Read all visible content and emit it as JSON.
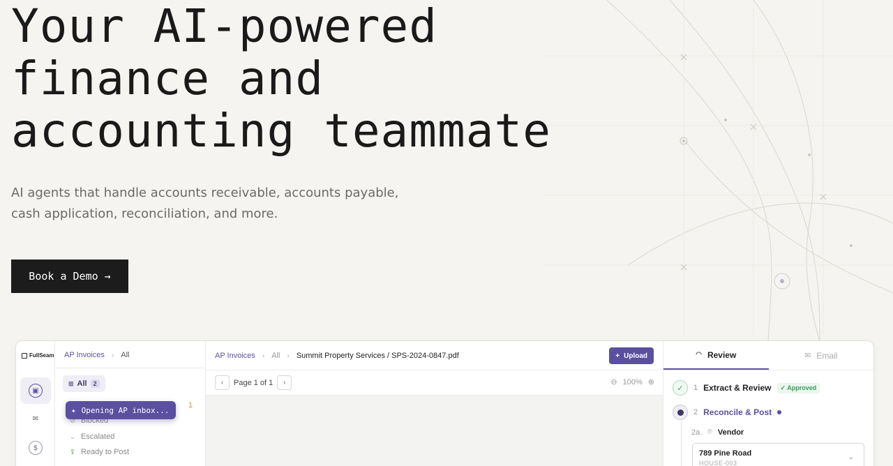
{
  "hero": {
    "title_lines": [
      "Your AI-powered",
      "finance and",
      "accounting teammate"
    ],
    "subtitle": "AI agents that handle accounts receivable, accounts payable, cash application, reconciliation, and more.",
    "cta_label": "Book a Demo →"
  },
  "app": {
    "brand": "FullSeam",
    "list_pane": {
      "breadcrumb": [
        "AP Invoices",
        "All"
      ],
      "filter_label": "All",
      "filter_count": "2",
      "badge_count": "1",
      "toast": "Opening AP inbox...",
      "statuses": [
        {
          "label": "Blocked",
          "icon": "blocked-icon"
        },
        {
          "label": "Escalated",
          "icon": "chevron-down-icon"
        },
        {
          "label": "Ready to Post",
          "icon": "upload-icon"
        }
      ]
    },
    "viewer": {
      "breadcrumb": [
        "AP Invoices",
        "All",
        "Summit Property Services / SPS-2024-0847.pdf"
      ],
      "upload_label": "Upload",
      "page_label": "Page 1 of 1",
      "zoom_label": "100%"
    },
    "review": {
      "tabs": [
        "Review",
        "Email"
      ],
      "steps": [
        {
          "index": "1",
          "label": "Extract & Review",
          "badge": "Approved"
        },
        {
          "index": "2",
          "label": "Reconcile & Post"
        }
      ],
      "substep": {
        "index": "2a.",
        "label": "Vendor"
      },
      "vendor": {
        "address": "789 Pine Road",
        "code": "HOUSE-003"
      }
    }
  }
}
